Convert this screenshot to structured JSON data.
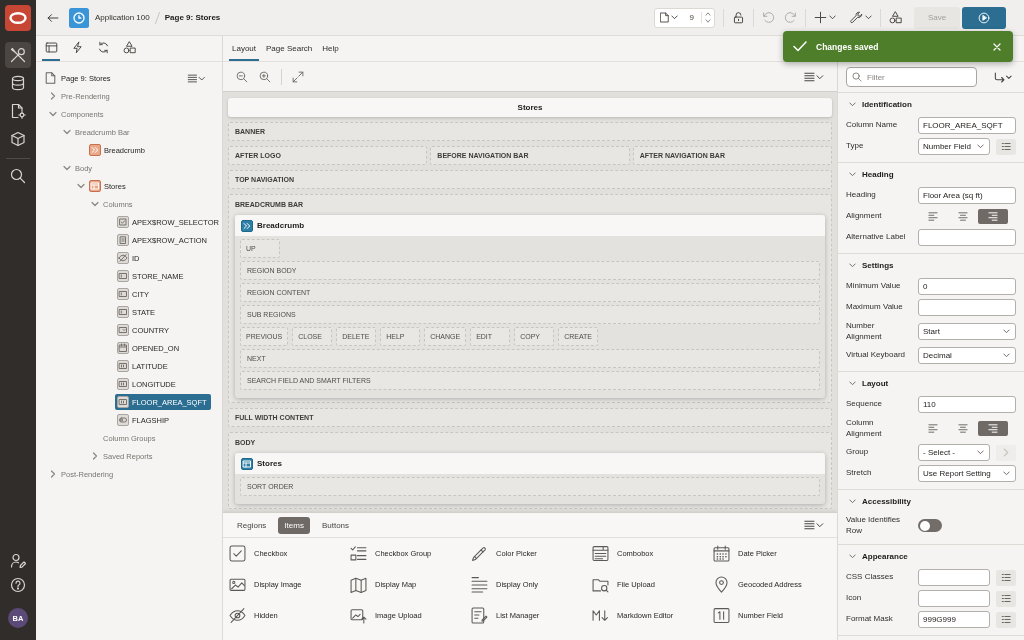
{
  "nav_rail": {
    "items": [
      {
        "kind": "tools",
        "selected": true
      },
      {
        "kind": "database",
        "selected": false
      },
      {
        "kind": "document",
        "selected": false
      },
      {
        "kind": "package",
        "selected": false
      },
      {
        "kind": "search",
        "selected": false
      }
    ],
    "avatar": "BA"
  },
  "header": {
    "application": "Application 100",
    "page": "Page 9: Stores",
    "page_number": "9",
    "save_button": {
      "label": "Save",
      "disabled": true
    }
  },
  "toast": {
    "message": "Changes saved"
  },
  "tree_panel": {
    "tabs": [
      {
        "kind": "rendering",
        "selected": true
      },
      {
        "kind": "dynamic-actions",
        "selected": false
      },
      {
        "kind": "processing",
        "selected": false
      },
      {
        "kind": "shared",
        "selected": false
      }
    ],
    "root": "Page 9: Stores",
    "nodes": [
      {
        "label": "Pre-Rendering",
        "expanded": false,
        "selected": false
      },
      {
        "label": "Components",
        "expanded": true,
        "selected": false,
        "children": [
          {
            "label": "Breadcrumb Bar",
            "expanded": true,
            "selected": false,
            "children": [
              {
                "label": "Breadcrumb",
                "kind": "breadcrumb",
                "selected": false
              }
            ]
          },
          {
            "label": "Body",
            "expanded": true,
            "selected": false,
            "children": [
              {
                "label": "Stores",
                "kind": "report",
                "expanded": true,
                "selected": false,
                "children": [
                  {
                    "label": "Columns",
                    "expanded": true,
                    "selected": false,
                    "children": [
                      {
                        "label": "APEX$ROW_SELECTOR",
                        "kind": "row-selector",
                        "selected": false
                      },
                      {
                        "label": "APEX$ROW_ACTION",
                        "kind": "row-action",
                        "selected": false
                      },
                      {
                        "label": "ID",
                        "kind": "hidden",
                        "selected": false
                      },
                      {
                        "label": "STORE_NAME",
                        "kind": "text",
                        "selected": false
                      },
                      {
                        "label": "CITY",
                        "kind": "text",
                        "selected": false
                      },
                      {
                        "label": "STATE",
                        "kind": "text",
                        "selected": false
                      },
                      {
                        "label": "COUNTRY",
                        "kind": "select",
                        "selected": false
                      },
                      {
                        "label": "OPENED_ON",
                        "kind": "date",
                        "selected": false
                      },
                      {
                        "label": "LATITUDE",
                        "kind": "number",
                        "selected": false
                      },
                      {
                        "label": "LONGITUDE",
                        "kind": "number",
                        "selected": false
                      },
                      {
                        "label": "FLOOR_AREA_SQFT",
                        "kind": "number",
                        "selected": true
                      },
                      {
                        "label": "FLAGSHIP",
                        "kind": "switch",
                        "selected": false
                      }
                    ]
                  },
                  {
                    "label": "Column Groups",
                    "selected": false
                  },
                  {
                    "label": "Saved Reports",
                    "expanded": false,
                    "selected": false
                  }
                ]
              }
            ]
          }
        ]
      },
      {
        "label": "Post-Rendering",
        "expanded": false,
        "selected": false
      }
    ]
  },
  "layout_panel": {
    "tabs": [
      {
        "label": "Layout",
        "selected": true
      },
      {
        "label": "Page Search",
        "selected": false
      },
      {
        "label": "Help",
        "selected": false
      }
    ],
    "canvas": {
      "title": "Stores",
      "rows": [
        {
          "kind": "slot",
          "label": "BANNER"
        },
        {
          "kind": "split",
          "labels": [
            "AFTER LOGO",
            "BEFORE NAVIGATION BAR",
            "AFTER NAVIGATION BAR"
          ]
        },
        {
          "kind": "slot",
          "label": "TOP NAVIGATION"
        },
        {
          "kind": "container",
          "label": "BREADCRUMB BAR",
          "region": {
            "title": "Breadcrumb",
            "kind": "breadcrumb",
            "rows": [
              {
                "kind": "buttons",
                "labels": [
                  "UP"
                ]
              },
              {
                "kind": "slot",
                "label": "REGION BODY"
              },
              {
                "kind": "slot",
                "label": "REGION CONTENT"
              },
              {
                "kind": "slot",
                "label": "SUB REGIONS"
              },
              {
                "kind": "buttons",
                "labels": [
                  "PREVIOUS",
                  "CLOSE",
                  "DELETE",
                  "HELP",
                  "CHANGE",
                  "EDIT",
                  "COPY",
                  "CREATE"
                ]
              },
              {
                "kind": "slot",
                "label": "NEXT"
              },
              {
                "kind": "slot",
                "label": "SEARCH FIELD AND SMART FILTERS"
              }
            ]
          }
        },
        {
          "kind": "slot",
          "label": "FULL WIDTH CONTENT"
        },
        {
          "kind": "container",
          "label": "BODY",
          "region": {
            "title": "Stores",
            "kind": "report",
            "rows": [
              {
                "kind": "slot",
                "label": "SORT ORDER"
              }
            ]
          }
        }
      ]
    }
  },
  "gallery": {
    "tabs": [
      {
        "label": "Regions",
        "selected": false
      },
      {
        "label": "Items",
        "selected": true
      },
      {
        "label": "Buttons",
        "selected": false
      }
    ],
    "items": [
      {
        "label": "Checkbox",
        "kind": "checkbox"
      },
      {
        "label": "Checkbox Group",
        "kind": "checkbox-group"
      },
      {
        "label": "Color Picker",
        "kind": "color-picker"
      },
      {
        "label": "Combobox",
        "kind": "combobox"
      },
      {
        "label": "Date Picker",
        "kind": "date-picker"
      },
      {
        "label": "Display Image",
        "kind": "display-image"
      },
      {
        "label": "Display Map",
        "kind": "display-map"
      },
      {
        "label": "Display Only",
        "kind": "display-only"
      },
      {
        "label": "File Upload",
        "kind": "file-upload"
      },
      {
        "label": "Geocoded Address",
        "kind": "geocoded-address"
      },
      {
        "label": "Hidden",
        "kind": "hidden"
      },
      {
        "label": "Image Upload",
        "kind": "image-upload"
      },
      {
        "label": "List Manager",
        "kind": "list-manager"
      },
      {
        "label": "Markdown Editor",
        "kind": "markdown-editor"
      },
      {
        "label": "Number Field",
        "kind": "number-field"
      }
    ]
  },
  "property_editor": {
    "filter": {
      "placeholder": "Filter"
    },
    "sections": [
      {
        "title": "Identification",
        "expanded": true,
        "rows": [
          {
            "label": "Column Name",
            "kind": "text",
            "value": "FLOOR_AREA_SQFT"
          },
          {
            "label": "Type",
            "kind": "select",
            "value": "Number Field",
            "action": {
              "kind": "list",
              "disabled": false
            }
          }
        ]
      },
      {
        "title": "Heading",
        "expanded": true,
        "rows": [
          {
            "label": "Heading",
            "kind": "text",
            "value": "Floor Area (sq ft)"
          },
          {
            "label": "Alignment",
            "kind": "align",
            "options": [
              {
                "kind": "left",
                "selected": false
              },
              {
                "kind": "center",
                "selected": false
              },
              {
                "kind": "right",
                "selected": true
              }
            ]
          },
          {
            "label": "Alternative Label",
            "kind": "text"
          }
        ]
      },
      {
        "title": "Settings",
        "expanded": true,
        "rows": [
          {
            "label": "Minimum Value",
            "kind": "text",
            "value": "0"
          },
          {
            "label": "Maximum Value",
            "kind": "text"
          },
          {
            "label": "Number Alignment",
            "kind": "select",
            "value": "Start"
          },
          {
            "label": "Virtual Keyboard",
            "kind": "select",
            "value": "Decimal"
          }
        ]
      },
      {
        "title": "Layout",
        "expanded": true,
        "rows": [
          {
            "label": "Sequence",
            "kind": "text",
            "value": "110"
          },
          {
            "label": "Column Alignment",
            "kind": "align",
            "options": [
              {
                "kind": "left",
                "selected": false
              },
              {
                "kind": "center",
                "selected": false
              },
              {
                "kind": "right",
                "selected": true
              }
            ]
          },
          {
            "label": "Group",
            "kind": "select",
            "value": "- Select -",
            "action": {
              "kind": "next",
              "disabled": true
            }
          },
          {
            "label": "Stretch",
            "kind": "select",
            "value": "Use Report Setting"
          }
        ]
      },
      {
        "title": "Accessibility",
        "expanded": true,
        "rows": [
          {
            "label": "Value Identifies Row",
            "kind": "switch",
            "on": false
          }
        ]
      },
      {
        "title": "Appearance",
        "expanded": true,
        "rows": [
          {
            "label": "CSS Classes",
            "kind": "text",
            "action": {
              "kind": "list",
              "disabled": false
            }
          },
          {
            "label": "Icon",
            "kind": "text",
            "action": {
              "kind": "list",
              "disabled": false
            }
          },
          {
            "label": "Format Mask",
            "kind": "text",
            "value": "999G999",
            "action": {
              "kind": "list",
              "disabled": false
            }
          }
        ]
      }
    ]
  }
}
